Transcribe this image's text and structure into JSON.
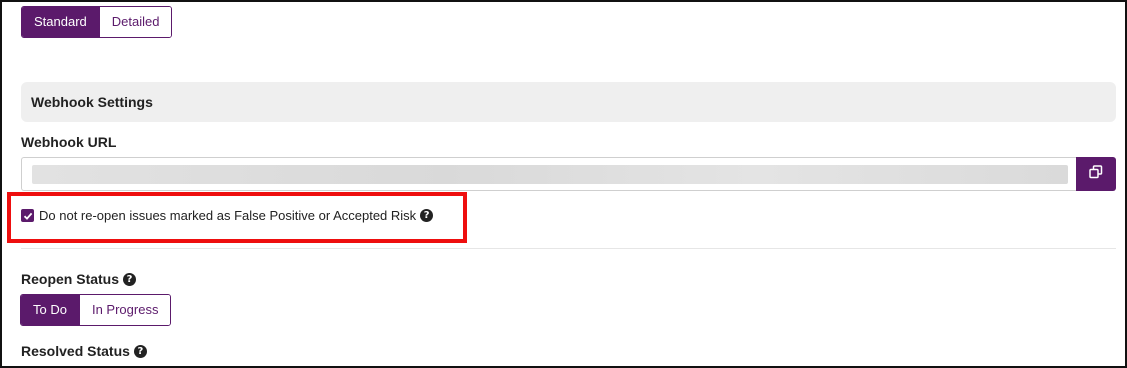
{
  "view_toggle": {
    "options": [
      "Standard",
      "Detailed"
    ],
    "selected": "Standard"
  },
  "webhook": {
    "section_title": "Webhook Settings",
    "url_label": "Webhook URL",
    "copy_icon": "copy-icon"
  },
  "reopen_checkbox": {
    "label": "Do not re-open issues marked as False Positive or Accepted Risk",
    "checked": true,
    "help_icon": "question-circle-icon"
  },
  "reopen_status": {
    "label": "Reopen Status",
    "options": [
      "To Do",
      "In Progress"
    ],
    "selected": "To Do"
  },
  "resolved_status": {
    "label": "Resolved Status"
  },
  "colors": {
    "accent": "#5b1a6b",
    "highlight": "#ee0e0e",
    "header_bg": "#efefef"
  }
}
